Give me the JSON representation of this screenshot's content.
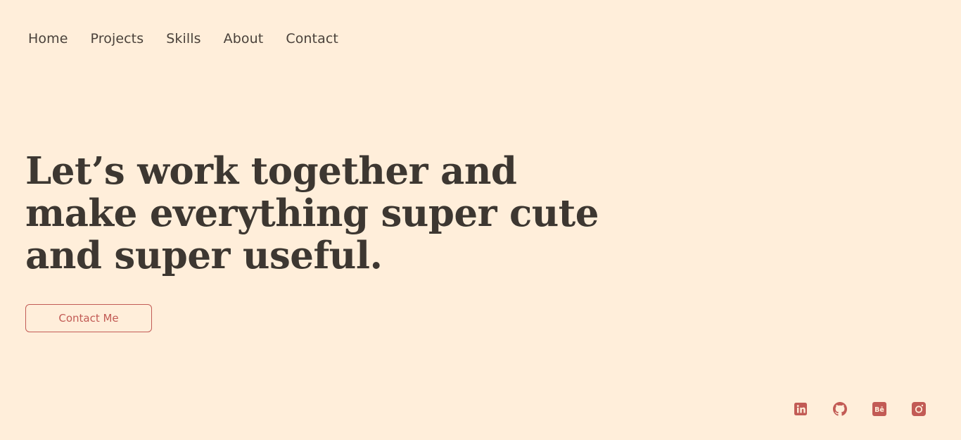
{
  "nav": {
    "items": [
      {
        "label": "Home"
      },
      {
        "label": "Projects"
      },
      {
        "label": "Skills"
      },
      {
        "label": "About"
      },
      {
        "label": "Contact"
      }
    ]
  },
  "hero": {
    "title": "Let’s work together and make everything super cute and super useful.",
    "cta_label": "Contact Me"
  },
  "social": {
    "icons": [
      "linkedin-icon",
      "github-icon",
      "behance-icon",
      "instagram-icon"
    ]
  },
  "colors": {
    "background": "#ffeeda",
    "text": "#3d3731",
    "accent": "#c25b55"
  }
}
